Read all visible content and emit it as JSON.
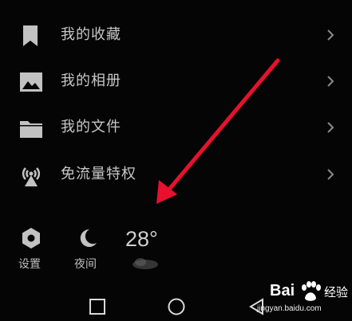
{
  "menu": {
    "items": [
      {
        "id": "favorites",
        "label": "我的收藏",
        "icon": "bookmark-icon"
      },
      {
        "id": "albums",
        "label": "我的相册",
        "icon": "image-icon"
      },
      {
        "id": "files",
        "label": "我的文件",
        "icon": "folder-icon"
      },
      {
        "id": "free-data",
        "label": "免流量特权",
        "icon": "signal-tower-icon"
      }
    ]
  },
  "bottom_bar": {
    "settings_label": "设置",
    "night_label": "夜间",
    "temperature": "28°"
  },
  "nav_bar": {
    "buttons": [
      "recent-apps-square-icon",
      "home-circle-icon",
      "back-triangle-icon"
    ]
  },
  "watermark": {
    "brand": "Bai",
    "brand_suffix": "经验",
    "url": "jingyan.baidu.com"
  },
  "colors": {
    "background": "#050505",
    "text": "#c7c7c7",
    "icon": "#c2c2c2",
    "arrow": "#e8112d"
  }
}
